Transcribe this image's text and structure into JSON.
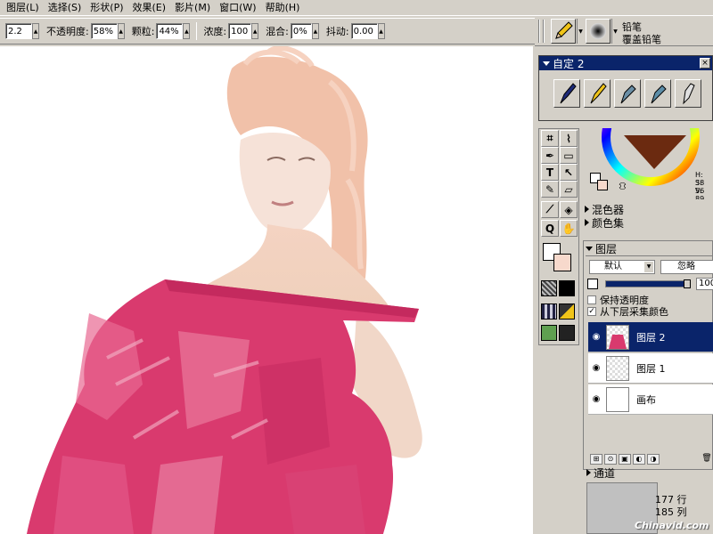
{
  "menubar": {
    "items": [
      "图层(L)",
      "选择(S)",
      "形状(P)",
      "效果(E)",
      "影片(M)",
      "窗口(W)",
      "帮助(H)"
    ]
  },
  "property_bar": {
    "size_value": "2.2",
    "opacity_label": "不透明度:",
    "opacity_value": "58%",
    "grain_label": "颗粒:",
    "grain_value": "44%",
    "density_label": "浓度:",
    "density_value": "100",
    "blend_label": "混合:",
    "blend_value": "0%",
    "jitter_label": "抖动:",
    "jitter_value": "0.00"
  },
  "brush_selector": {
    "category": "铅笔",
    "variant": "覆盖铅笔"
  },
  "custom_palette": {
    "title": "自定 2",
    "close": "×"
  },
  "toolbox": {
    "text_tool": "T",
    "magnifier": "Q"
  },
  "color_panel": {
    "h": "H: 38",
    "s": "S: 56",
    "v": "V: 89",
    "mixer_label": "混色器",
    "color_sets_label": "颜色集",
    "main_color": "#ffffff",
    "secondary_color": "#f7d9cc"
  },
  "layers_panel": {
    "title": "图层",
    "composite_method": "默认",
    "composite_depth": "忽略",
    "opacity_value": "100",
    "preserve_transparency": "保持透明度",
    "pick_up_underlying": "从下层采集颜色",
    "layers": [
      {
        "name": "图层 2",
        "selected": true
      },
      {
        "name": "图层 1",
        "selected": false
      },
      {
        "name": "画布",
        "selected": false
      }
    ],
    "channels_label": "通道"
  },
  "status": {
    "rows": "177 行",
    "cols": "185 列",
    "watermark": "Chinavid.com"
  },
  "colors": {
    "accent": "#0a246a",
    "chrome": "#d4d0c8",
    "dress_pink": "#d93a6e"
  }
}
